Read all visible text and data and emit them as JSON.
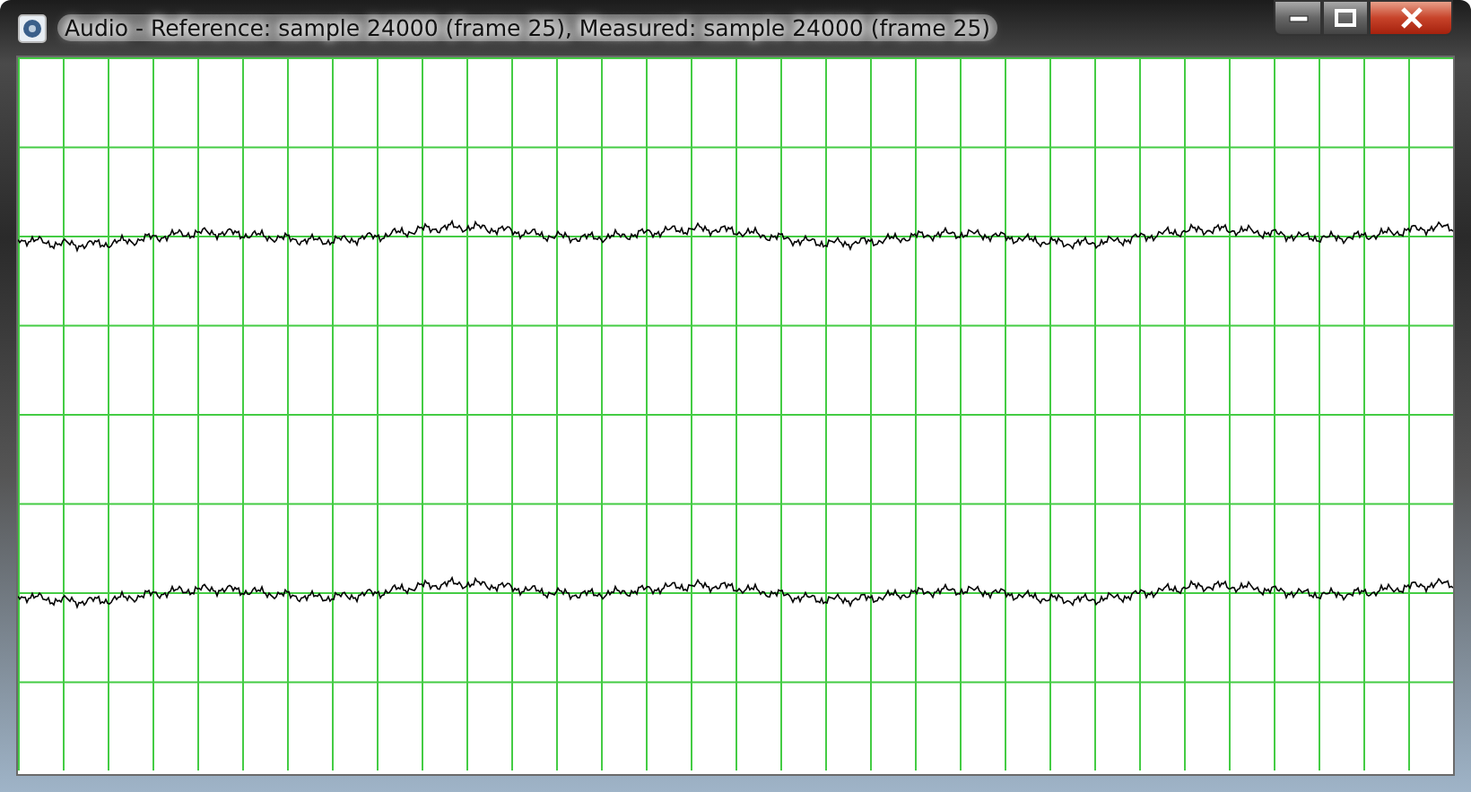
{
  "window": {
    "title": "Audio - Reference: sample 24000 (frame 25), Measured: sample 24000 (frame 25)"
  }
}
